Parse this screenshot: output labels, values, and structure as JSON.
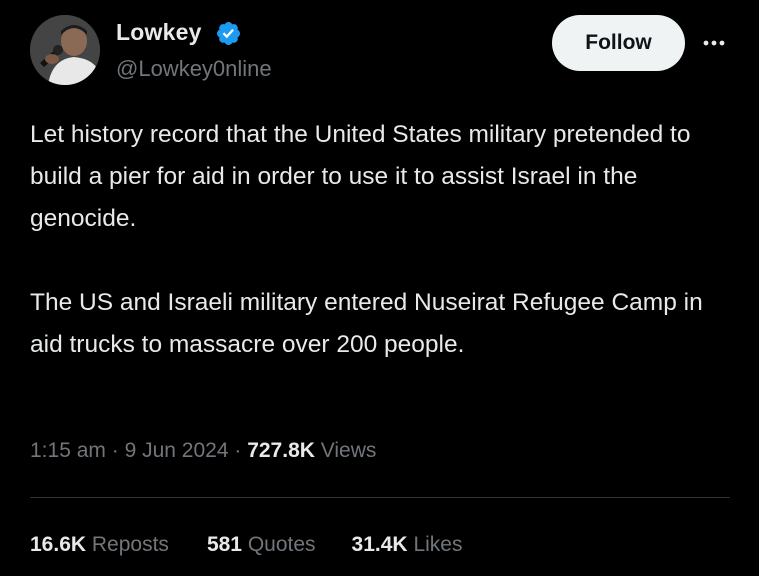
{
  "author": {
    "display_name": "Lowkey",
    "handle": "@Lowkey0nline",
    "verified": true,
    "avatar_icon": "profile-photo-microphone"
  },
  "actions": {
    "follow_label": "Follow",
    "more_icon": "more-options-icon"
  },
  "post": {
    "paragraphs": [
      "Let history record that the United States military pretended to build a pier for aid in order to use it to assist Israel in the genocide.",
      "The US and Israeli military entered Nuseirat Refugee Camp in aid trucks to massacre over 200 people."
    ],
    "time": "1:15 am",
    "date": "9 Jun 2024",
    "views_count": "727.8K",
    "views_label": "Views",
    "separator": "·"
  },
  "stats": {
    "reposts": {
      "count": "16.6K",
      "label": "Reposts"
    },
    "quotes": {
      "count": "581",
      "label": "Quotes"
    },
    "likes": {
      "count": "31.4K",
      "label": "Likes"
    }
  },
  "colors": {
    "background": "#000000",
    "text_primary": "#e7e9ea",
    "text_secondary": "#71767b",
    "verified_blue": "#1d9bf0",
    "divider": "#2f3336",
    "follow_bg": "#eff3f4"
  }
}
